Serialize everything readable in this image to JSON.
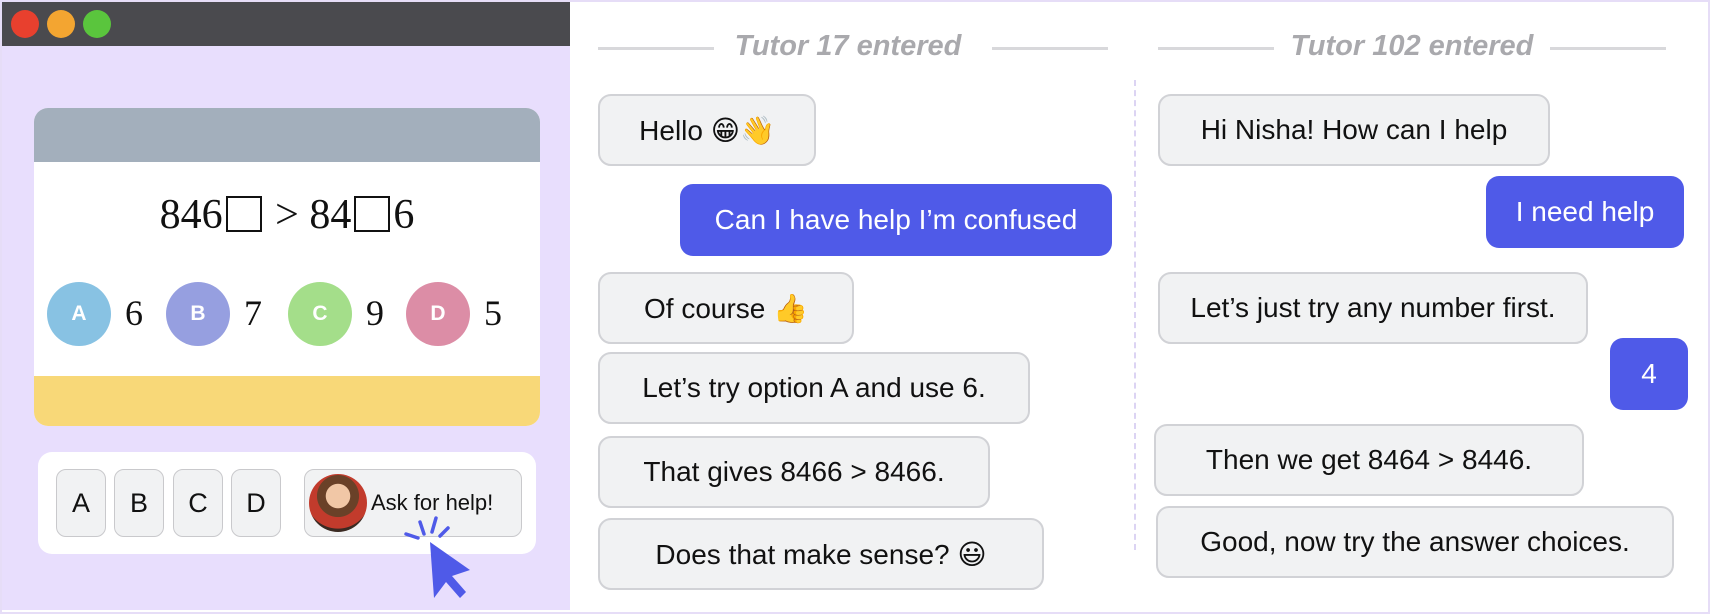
{
  "problem": {
    "eq_left_digits": "846",
    "comparison": ">",
    "eq_right_prefix": "84",
    "eq_right_suffix": "6",
    "options": [
      {
        "letter": "A",
        "value": "6",
        "color": "#88c2e3"
      },
      {
        "letter": "B",
        "value": "7",
        "color": "#969fe0"
      },
      {
        "letter": "C",
        "value": "9",
        "color": "#a4de8a"
      },
      {
        "letter": "D",
        "value": "5",
        "color": "#dc8da6"
      }
    ]
  },
  "answer_bar": {
    "buttons": [
      "A",
      "B",
      "C",
      "D"
    ],
    "help_label": "Ask for help!"
  },
  "chats": {
    "left": {
      "header": "Tutor 17 entered",
      "messages": [
        {
          "role": "tutor",
          "text": "Hello 😁👋"
        },
        {
          "role": "student",
          "text": "Can I have help I’m confused"
        },
        {
          "role": "tutor",
          "text": "Of course 👍"
        },
        {
          "role": "tutor",
          "text": "Let’s try option A and use 6."
        },
        {
          "role": "tutor",
          "text": "That gives 8466 > 8466."
        },
        {
          "role": "tutor",
          "text": "Does that make sense? 😃"
        }
      ]
    },
    "right": {
      "header": "Tutor 102 entered",
      "messages": [
        {
          "role": "tutor",
          "text": "Hi Nisha! How can I help"
        },
        {
          "role": "student",
          "text": "I need help"
        },
        {
          "role": "tutor",
          "text": "Let’s just try any number first."
        },
        {
          "role": "student",
          "text": "4"
        },
        {
          "role": "tutor",
          "text": "Then we get 8464 > 8446."
        },
        {
          "role": "tutor",
          "text": "Good, now try the answer choices."
        }
      ]
    }
  },
  "colors": {
    "student_bubble": "#4f5ae8",
    "tutor_bubble": "#f1f2f3",
    "left_panel_bg": "#e8defd",
    "card_header": "#a3afbc",
    "card_footer": "#f8d878"
  }
}
